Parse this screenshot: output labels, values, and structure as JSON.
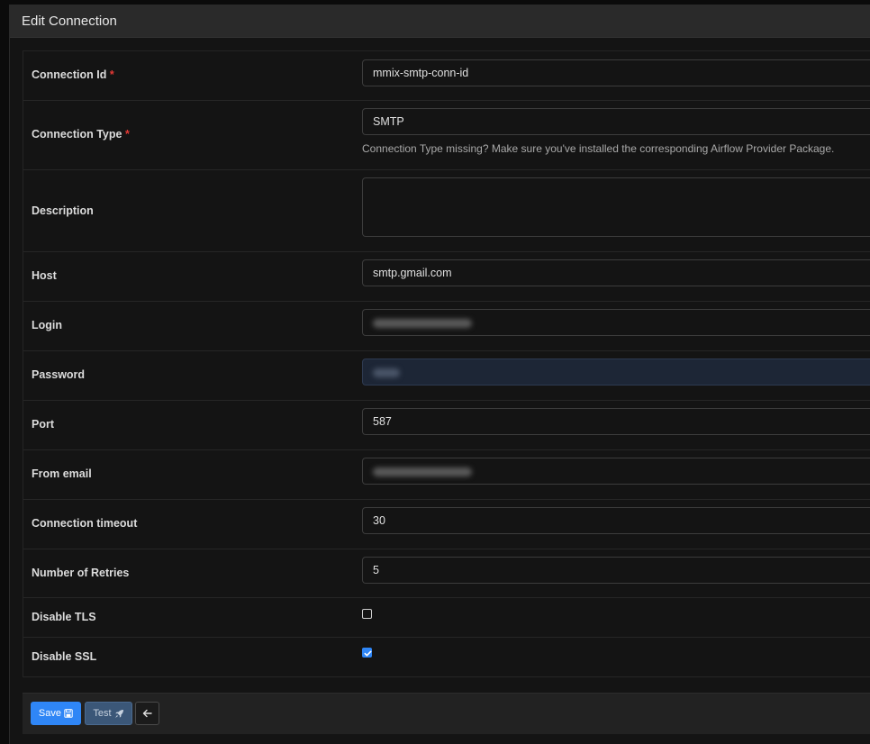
{
  "panel": {
    "title": "Edit Connection"
  },
  "fields": {
    "conn_id": {
      "label": "Connection Id",
      "required_mark": "*",
      "value": "mmix-smtp-conn-id"
    },
    "conn_type": {
      "label": "Connection Type",
      "required_mark": "*",
      "value": "SMTP",
      "helper": "Connection Type missing? Make sure you've installed the corresponding Airflow Provider Package."
    },
    "description": {
      "label": "Description",
      "value": ""
    },
    "host": {
      "label": "Host",
      "value": "smtp.gmail.com"
    },
    "login": {
      "label": "Login"
    },
    "password": {
      "label": "Password"
    },
    "port": {
      "label": "Port",
      "value": "587"
    },
    "from_email": {
      "label": "From email"
    },
    "timeout": {
      "label": "Connection timeout",
      "value": "30"
    },
    "retries": {
      "label": "Number of Retries",
      "value": "5"
    },
    "disable_tls": {
      "label": "Disable TLS",
      "checked": false
    },
    "disable_ssl": {
      "label": "Disable SSL",
      "checked": true
    }
  },
  "actions": {
    "save_label": "Save",
    "test_label": "Test",
    "save_icon": "floppy-disk-icon",
    "test_icon": "rocket-icon",
    "back_icon": "arrow-left-icon"
  },
  "colors": {
    "accent": "#2f86f6",
    "required": "#e53935",
    "background": "#141414",
    "header": "#2a2a2a"
  }
}
